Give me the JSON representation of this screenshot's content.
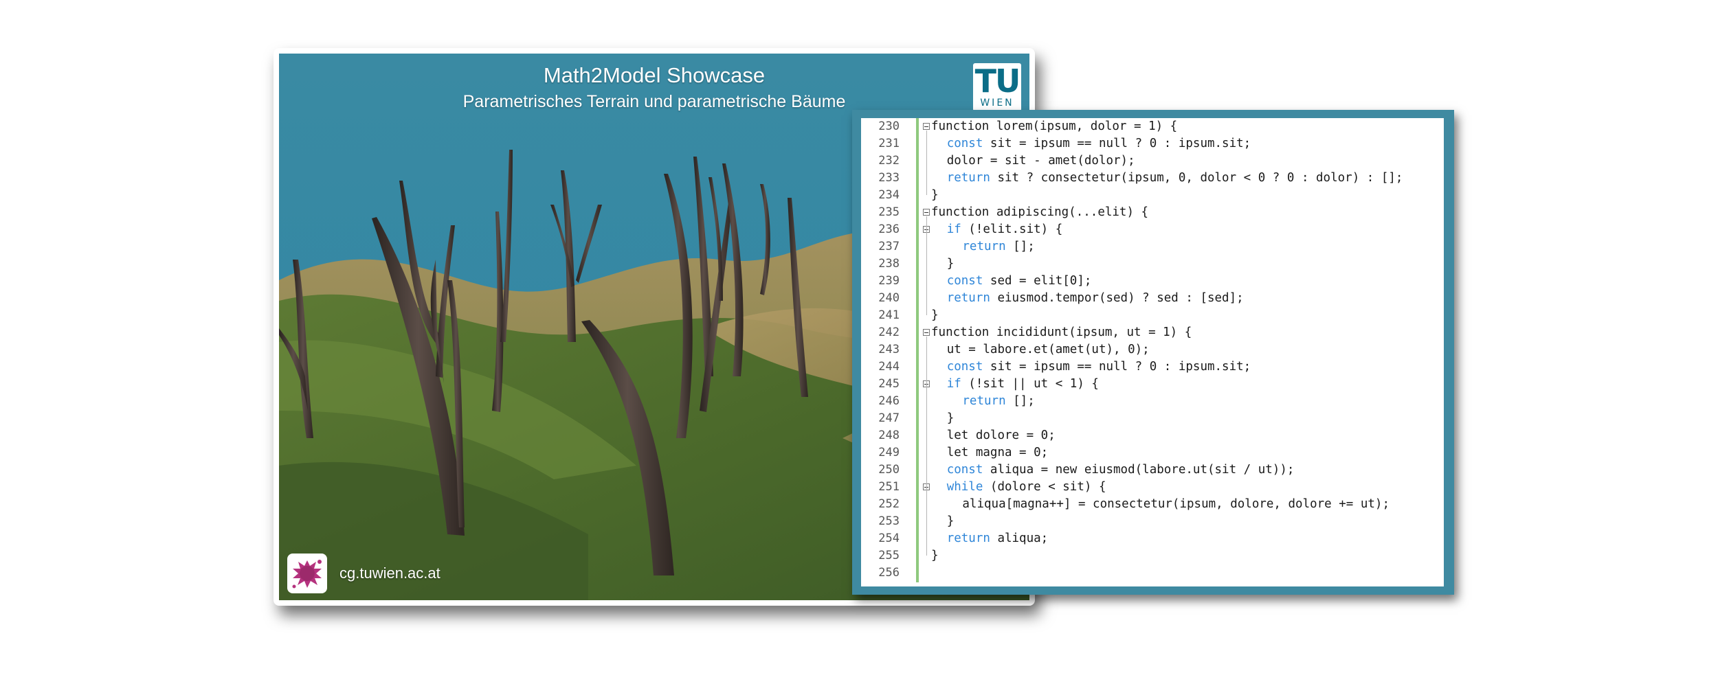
{
  "showcase": {
    "title": "Math2Model Showcase",
    "subtitle": "Parametrisches Terrain und parametrische Bäume",
    "logo": {
      "line1": "TU",
      "line2": "WIEN",
      "color": "#0b6d87"
    },
    "footer_url": "cg.tuwien.ac.at",
    "footer_logo_icon": "cg-splat-icon",
    "sky_color": "#3d8ea6"
  },
  "code": {
    "keyword_color": "#2f86d8",
    "frame_color": "#3f8aa1",
    "lines": [
      {
        "n": "230",
        "indent": 0,
        "fold": true,
        "tokens": [
          {
            "t": "function lorem(ipsum, dolor = 1) {"
          }
        ]
      },
      {
        "n": "231",
        "indent": 1,
        "fold": false,
        "tokens": [
          {
            "t": "const",
            "k": 1
          },
          {
            "t": " sit = ipsum == null ? 0 : ipsum.sit;"
          }
        ]
      },
      {
        "n": "232",
        "indent": 1,
        "fold": false,
        "tokens": [
          {
            "t": "dolor = sit - amet(dolor);"
          }
        ]
      },
      {
        "n": "233",
        "indent": 1,
        "fold": false,
        "tokens": [
          {
            "t": "return",
            "k": 1
          },
          {
            "t": " sit ? consectetur(ipsum, 0, dolor < 0 ? 0 : dolor) : [];"
          }
        ]
      },
      {
        "n": "234",
        "indent": 0,
        "fold": false,
        "tokens": [
          {
            "t": "}"
          }
        ]
      },
      {
        "n": "235",
        "indent": 0,
        "fold": true,
        "tokens": [
          {
            "t": "function adipiscing(...elit) {"
          }
        ]
      },
      {
        "n": "236",
        "indent": 1,
        "fold": true,
        "tokens": [
          {
            "t": "if",
            "k": 1
          },
          {
            "t": " (!elit.sit) {"
          }
        ]
      },
      {
        "n": "237",
        "indent": 2,
        "fold": false,
        "tokens": [
          {
            "t": "return",
            "k": 1
          },
          {
            "t": " [];"
          }
        ]
      },
      {
        "n": "238",
        "indent": 1,
        "fold": false,
        "tokens": [
          {
            "t": "}"
          }
        ]
      },
      {
        "n": "239",
        "indent": 1,
        "fold": false,
        "tokens": [
          {
            "t": "const",
            "k": 1
          },
          {
            "t": " sed = elit[0];"
          }
        ]
      },
      {
        "n": "240",
        "indent": 1,
        "fold": false,
        "tokens": [
          {
            "t": "return",
            "k": 1
          },
          {
            "t": " eiusmod.tempor(sed) ? sed : [sed];"
          }
        ]
      },
      {
        "n": "241",
        "indent": 0,
        "fold": false,
        "tokens": [
          {
            "t": "}"
          }
        ]
      },
      {
        "n": "242",
        "indent": 0,
        "fold": true,
        "tokens": [
          {
            "t": "function incididunt(ipsum, ut = 1) {"
          }
        ]
      },
      {
        "n": "243",
        "indent": 1,
        "fold": false,
        "tokens": [
          {
            "t": "ut = labore.et(amet(ut), 0);"
          }
        ]
      },
      {
        "n": "244",
        "indent": 1,
        "fold": false,
        "tokens": [
          {
            "t": "const",
            "k": 1
          },
          {
            "t": " sit = ipsum == null ? 0 : ipsum.sit;"
          }
        ]
      },
      {
        "n": "245",
        "indent": 1,
        "fold": true,
        "tokens": [
          {
            "t": "if",
            "k": 1
          },
          {
            "t": " (!sit || ut < 1) {"
          }
        ]
      },
      {
        "n": "246",
        "indent": 2,
        "fold": false,
        "tokens": [
          {
            "t": "return",
            "k": 1
          },
          {
            "t": " [];"
          }
        ]
      },
      {
        "n": "247",
        "indent": 1,
        "fold": false,
        "tokens": [
          {
            "t": "}"
          }
        ]
      },
      {
        "n": "248",
        "indent": 1,
        "fold": false,
        "tokens": [
          {
            "t": "let dolore = 0;"
          }
        ]
      },
      {
        "n": "249",
        "indent": 1,
        "fold": false,
        "tokens": [
          {
            "t": "let magna = 0;"
          }
        ]
      },
      {
        "n": "250",
        "indent": 1,
        "fold": false,
        "tokens": [
          {
            "t": "const",
            "k": 1
          },
          {
            "t": " aliqua = new eiusmod(labore.ut(sit / ut));"
          }
        ]
      },
      {
        "n": "251",
        "indent": 1,
        "fold": true,
        "tokens": [
          {
            "t": "while",
            "k": 1
          },
          {
            "t": " (dolore < sit) {"
          }
        ]
      },
      {
        "n": "252",
        "indent": 2,
        "fold": false,
        "tokens": [
          {
            "t": "aliqua[magna++] = consectetur(ipsum, dolore, dolore += ut);"
          }
        ]
      },
      {
        "n": "253",
        "indent": 1,
        "fold": false,
        "tokens": [
          {
            "t": "}"
          }
        ]
      },
      {
        "n": "254",
        "indent": 1,
        "fold": false,
        "tokens": [
          {
            "t": "return",
            "k": 1
          },
          {
            "t": " aliqua;"
          }
        ]
      },
      {
        "n": "255",
        "indent": 0,
        "fold": false,
        "tokens": [
          {
            "t": "}"
          }
        ]
      },
      {
        "n": "256",
        "indent": 0,
        "fold": false,
        "tokens": [
          {
            "t": ""
          }
        ]
      }
    ]
  }
}
